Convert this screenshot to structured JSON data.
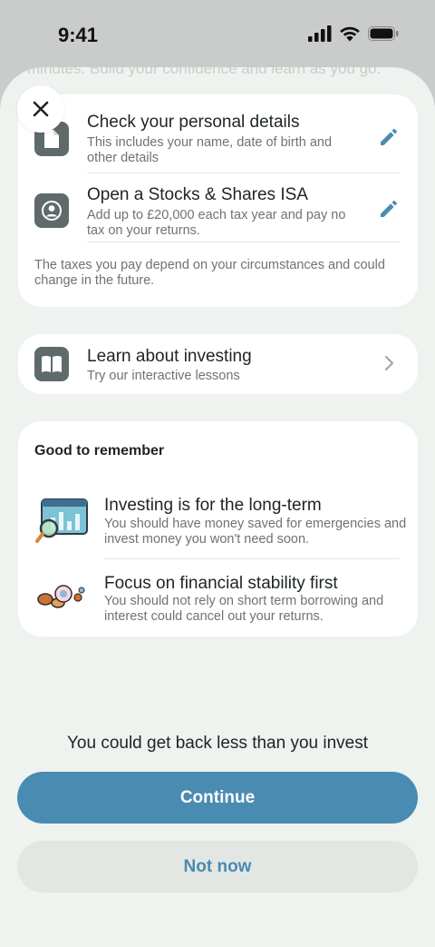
{
  "status": {
    "time": "9:41"
  },
  "intro_text": "minutes. Build your confidence and learn as you go.",
  "steps": [
    {
      "title": "Check your personal details",
      "subtitle": "This includes your name, date of birth and other details",
      "icon": "document-icon",
      "action_icon": "pencil-icon"
    },
    {
      "title": "Open a Stocks & Shares ISA",
      "subtitle": "Add up to £20,000 each tax year and pay no tax on your returns.",
      "icon": "person-badge-icon",
      "action_icon": "pencil-icon"
    }
  ],
  "tax_note": "The taxes you pay depend on your circumstances and could change in the future.",
  "learn": {
    "title": "Learn about investing",
    "subtitle": "Try our interactive lessons",
    "icon": "book-icon"
  },
  "remember": {
    "heading": "Good to remember",
    "items": [
      {
        "title": "Investing is for the long-term",
        "subtitle": "You should have money saved for emergencies and invest money you won't need soon.",
        "icon": "chart-magnifier-icon"
      },
      {
        "title": "Focus on financial stability first",
        "subtitle": "You should not rely on short term borrowing and interest could cancel out your returns.",
        "icon": "coins-icon"
      }
    ]
  },
  "disclaimer": "You could get back less than you invest",
  "buttons": {
    "continue": "Continue",
    "not_now": "Not now"
  },
  "colors": {
    "accent": "#4a8bb2",
    "background": "#eef3ef",
    "icon_gray": "#5f6a6b"
  }
}
